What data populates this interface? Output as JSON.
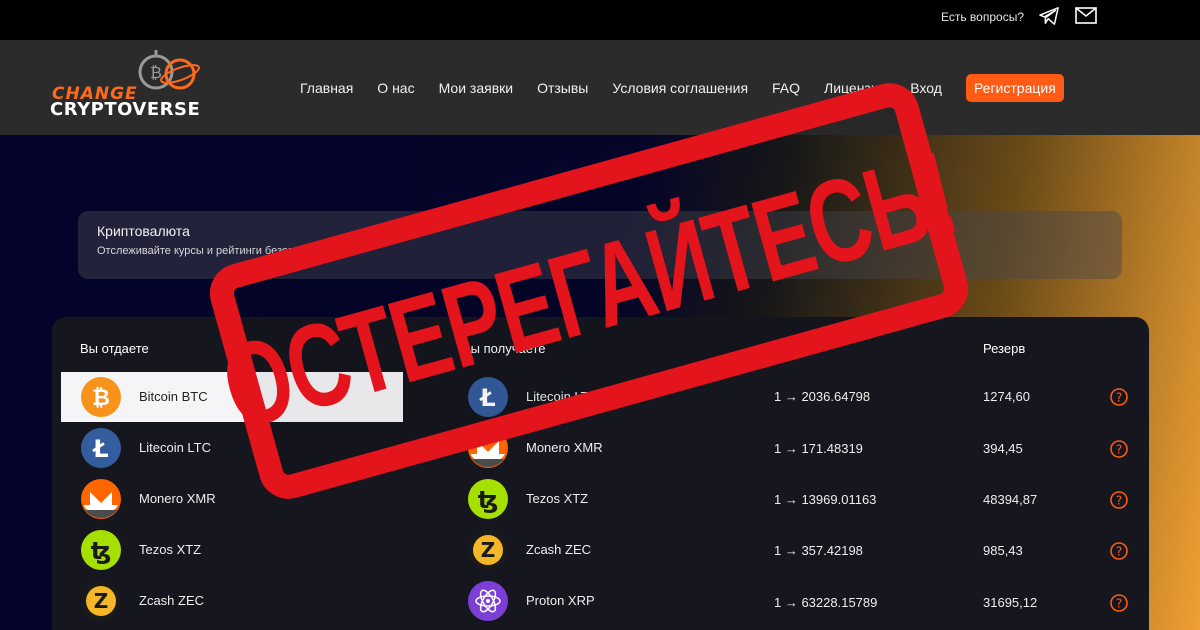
{
  "topbar": {
    "question": "Есть вопросы?",
    "icons": [
      "telegram-icon",
      "mail-icon"
    ]
  },
  "logo": {
    "line1": "CHANGE",
    "line2": "CRYPTOVERSE"
  },
  "nav": {
    "items": [
      "Главная",
      "О нас",
      "Мои заявки",
      "Отзывы",
      "Условия соглашения",
      "FAQ",
      "Лицензия",
      "Вход"
    ],
    "register": "Регистрация"
  },
  "banner": {
    "title": "Криптовалюта",
    "subtitle": "Отслеживайте курсы и рейтинги безопасности."
  },
  "table": {
    "headers": {
      "give": "Вы отдаете",
      "get": "Вы получаете",
      "rate": "Курс",
      "reserve": "Резерв"
    },
    "give": [
      {
        "name": "Bitcoin BTC",
        "icon": "bitcoin-icon",
        "color": "#f7931a",
        "active": true
      },
      {
        "name": "Litecoin LTC",
        "icon": "litecoin-icon",
        "color": "#345d9d"
      },
      {
        "name": "Monero XMR",
        "icon": "monero-icon",
        "color": "#ff6600"
      },
      {
        "name": "Tezos XTZ",
        "icon": "tezos-icon",
        "color": "#a6e000"
      },
      {
        "name": "Zcash ZEC",
        "icon": "zcash-icon",
        "color": "#f4b728"
      }
    ],
    "get": [
      {
        "name": "Litecoin LTC",
        "icon": "litecoin-icon",
        "color": "#345d9d",
        "rate": "1 → 2036.64798",
        "reserve": "1274,60"
      },
      {
        "name": "Monero XMR",
        "icon": "monero-icon",
        "color": "#ff6600",
        "rate": "1 → 171.48319",
        "reserve": "394,45"
      },
      {
        "name": "Tezos XTZ",
        "icon": "tezos-icon",
        "color": "#a6e000",
        "rate": "1 → 13969.01163",
        "reserve": "48394,87"
      },
      {
        "name": "Zcash ZEC",
        "icon": "zcash-icon",
        "color": "#f4b728",
        "rate": "1 → 357.42198",
        "reserve": "985,43"
      },
      {
        "name": "Proton XRP",
        "icon": "proton-icon",
        "color": "#7b3fd6",
        "rate": "1 → 63228.15789",
        "reserve": "31695,12"
      }
    ]
  },
  "stamp": {
    "text": "ОСТЕРЕГАЙТЕСЬ!"
  },
  "colors": {
    "accent": "#ff5b14",
    "stamp": "#e3141b",
    "help": "#ff5b14"
  }
}
